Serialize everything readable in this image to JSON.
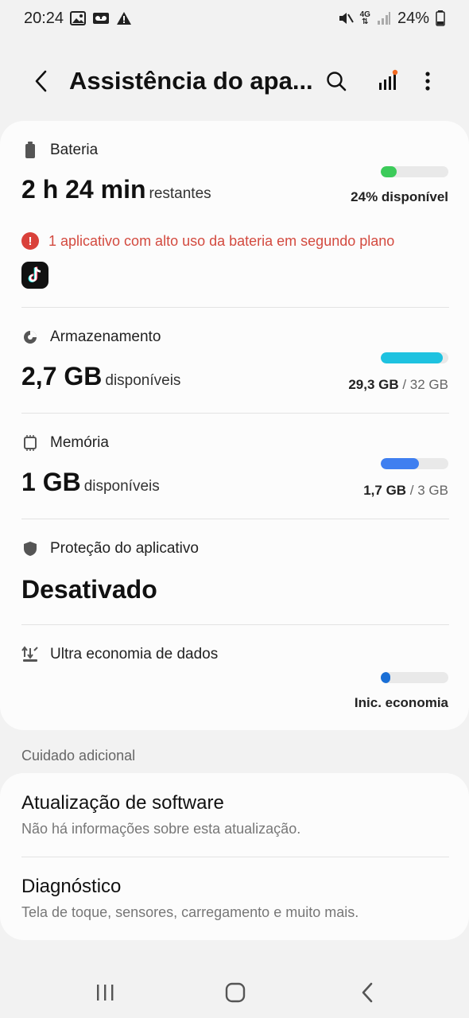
{
  "status": {
    "time": "20:24",
    "battery_pct": "24%",
    "network": "4G"
  },
  "appbar": {
    "title": "Assistência do apa..."
  },
  "battery": {
    "label": "Bateria",
    "value": "2 h 24 min",
    "unit": "restantes",
    "right": "24% disponível",
    "fill_fraction": 0.24,
    "color": "#3ccb5a",
    "warning": "1 aplicativo com alto uso da bateria em segundo plano"
  },
  "storage": {
    "label": "Armazenamento",
    "value": "2,7 GB",
    "unit": "disponíveis",
    "used": "29,3 GB",
    "sep": " / ",
    "total": "32 GB",
    "fill_fraction": 0.92,
    "color": "#1ec2e0"
  },
  "memory": {
    "label": "Memória",
    "value": "1 GB",
    "unit": "disponíveis",
    "used": "1,7 GB",
    "sep": " / ",
    "total": "3 GB",
    "fill_fraction": 0.57,
    "color": "#3f7ff0"
  },
  "protection": {
    "label": "Proteção do aplicativo",
    "value": "Desativado"
  },
  "datasaver": {
    "label": "Ultra economia de dados",
    "right": "Inic. economia",
    "fill_fraction": 0.05,
    "color": "#1a6fd6"
  },
  "extra": {
    "section_label": "Cuidado adicional",
    "items": [
      {
        "title": "Atualização de software",
        "subtitle": "Não há informações sobre esta atualização."
      },
      {
        "title": "Diagnóstico",
        "subtitle": "Tela de toque, sensores, carregamento e muito mais."
      }
    ]
  },
  "nav": {
    "recent": "recent-apps",
    "home": "home",
    "back": "back"
  }
}
